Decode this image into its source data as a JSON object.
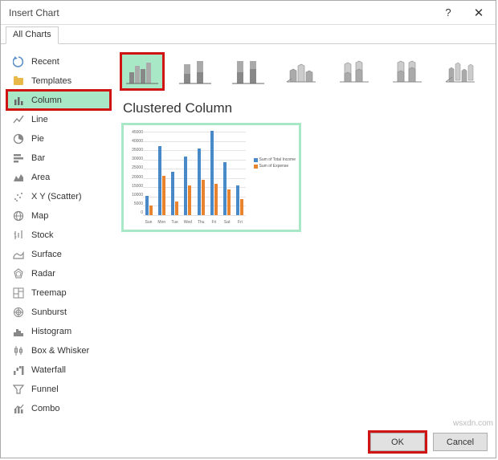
{
  "titlebar": {
    "title": "Insert Chart"
  },
  "tabs": {
    "allcharts": "All Charts"
  },
  "sidebar": {
    "items": [
      {
        "label": "Recent"
      },
      {
        "label": "Templates"
      },
      {
        "label": "Column"
      },
      {
        "label": "Line"
      },
      {
        "label": "Pie"
      },
      {
        "label": "Bar"
      },
      {
        "label": "Area"
      },
      {
        "label": "X Y (Scatter)"
      },
      {
        "label": "Map"
      },
      {
        "label": "Stock"
      },
      {
        "label": "Surface"
      },
      {
        "label": "Radar"
      },
      {
        "label": "Treemap"
      },
      {
        "label": "Sunburst"
      },
      {
        "label": "Histogram"
      },
      {
        "label": "Box & Whisker"
      },
      {
        "label": "Waterfall"
      },
      {
        "label": "Funnel"
      },
      {
        "label": "Combo"
      }
    ]
  },
  "main": {
    "chart_type_title": "Clustered Column"
  },
  "footer": {
    "ok": "OK",
    "cancel": "Cancel"
  },
  "watermark": "wsxdn.com",
  "chart_data": {
    "type": "bar",
    "categories": [
      "Sun",
      "Mon",
      "Tue",
      "Wed",
      "Thu",
      "Fri",
      "Sat",
      "Fri"
    ],
    "series": [
      {
        "name": "Sum of Total Income",
        "values": [
          10000,
          35000,
          22000,
          30000,
          34000,
          43000,
          27000,
          15000
        ],
        "color": "#4a89c8"
      },
      {
        "name": "Sum of Expense",
        "values": [
          5000,
          20000,
          7000,
          15000,
          18000,
          16000,
          13000,
          8000
        ],
        "color": "#e8832e"
      }
    ],
    "ylim": [
      0,
      45000
    ],
    "yticks": [
      0,
      5000,
      10000,
      15000,
      20000,
      25000,
      30000,
      35000,
      40000,
      45000
    ],
    "title": "",
    "xlabel": "",
    "ylabel": ""
  }
}
